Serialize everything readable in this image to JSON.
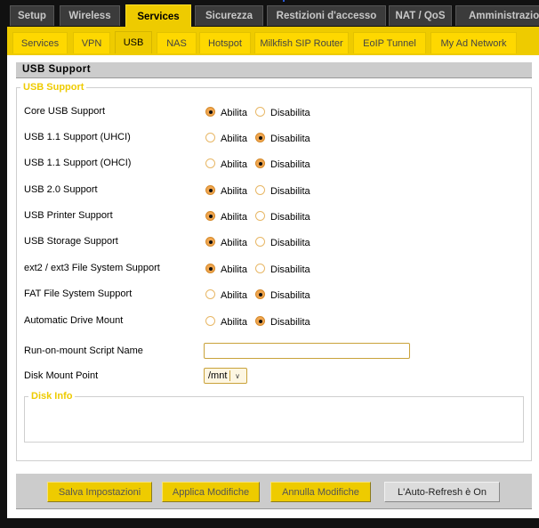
{
  "main_tabs": [
    {
      "label": "Setup",
      "active": false
    },
    {
      "label": "Wireless",
      "active": false
    },
    {
      "label": "Services",
      "active": true
    },
    {
      "label": "Sicurezza",
      "active": false
    },
    {
      "label": "Restizioni d'accesso",
      "active": false
    },
    {
      "label": "NAT / QoS",
      "active": false
    },
    {
      "label": "Amministrazione",
      "active": false
    }
  ],
  "sub_tabs": [
    {
      "label": "Services",
      "active": false
    },
    {
      "label": "VPN",
      "active": false
    },
    {
      "label": "USB",
      "active": true
    },
    {
      "label": "NAS",
      "active": false
    },
    {
      "label": "Hotspot",
      "active": false
    },
    {
      "label": "Milkfish SIP Router",
      "active": false
    },
    {
      "label": "EoIP Tunnel",
      "active": false
    },
    {
      "label": "My Ad Network",
      "active": false
    }
  ],
  "section_title": "USB Support",
  "fieldset_legend": "USB Support",
  "options": {
    "enable": "Abilita",
    "disable": "Disabilita"
  },
  "settings": [
    {
      "label": "Core USB Support",
      "value": "enable"
    },
    {
      "label": "USB 1.1 Support (UHCI)",
      "value": "disable"
    },
    {
      "label": "USB 1.1 Support (OHCI)",
      "value": "disable"
    },
    {
      "label": "USB 2.0 Support",
      "value": "enable"
    },
    {
      "label": "USB Printer Support",
      "value": "enable"
    },
    {
      "label": "USB Storage Support",
      "value": "enable"
    },
    {
      "label": "ext2 / ext3 File System Support",
      "value": "enable"
    },
    {
      "label": "FAT File System Support",
      "value": "disable"
    },
    {
      "label": "Automatic Drive Mount",
      "value": "disable"
    }
  ],
  "script_name": {
    "label": "Run-on-mount Script Name",
    "value": ""
  },
  "mount_point": {
    "label": "Disk Mount Point",
    "value": "/mnt"
  },
  "disk_info": {
    "legend": "Disk Info"
  },
  "buttons": {
    "save": "Salva Impostazioni",
    "apply": "Applica Modifiche",
    "cancel": "Annulla Modifiche",
    "autorefresh": "L'Auto-Refresh è On"
  },
  "colors": {
    "accent": "#eecb00",
    "tab_dark": "#3b3b3b",
    "legend": "#eecb00"
  }
}
